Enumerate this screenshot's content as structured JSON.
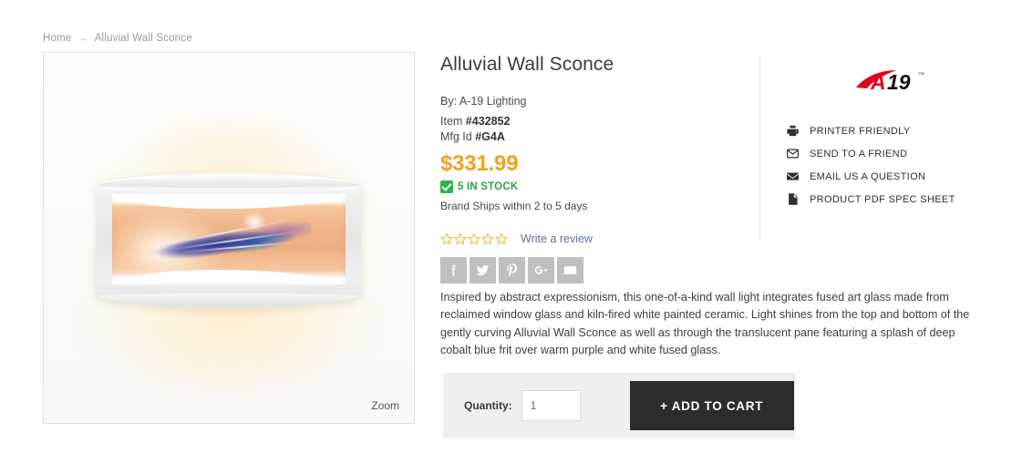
{
  "breadcrumb": {
    "home": "Home",
    "separator": "→",
    "current": "Alluvial Wall Sconce"
  },
  "gallery": {
    "zoom_label": "Zoom",
    "image_alt": "Alluvial Wall Sconce"
  },
  "product": {
    "title": "Alluvial Wall Sconce",
    "brand_line": "By: A-19 Lighting",
    "item_label": "Item ",
    "item_number": "#432852",
    "mfg_label": "Mfg Id ",
    "mfg_number": "#G4A",
    "price": "$331.99",
    "price_color": "#f5a01e",
    "stock_text": "5 IN STOCK",
    "stock_color": "#2e9d44",
    "shipping_text": "Brand Ships within 2 to 5 days",
    "description": "Inspired by abstract expressionism, this one-of-a-kind wall light integrates fused art glass made from reclaimed window glass and kiln-fired white painted ceramic. Light shines from the top and bottom of the gently curving Alluvial Wall Sconce as well as through the translucent pane featuring a splash of deep cobalt blue frit over warm purple and white fused glass."
  },
  "reviews": {
    "rating": 0,
    "star_count": 5,
    "star_color": "#f0b323",
    "write_review_label": "Write a review"
  },
  "social": {
    "buttons": [
      {
        "name": "facebook",
        "label": "f"
      },
      {
        "name": "twitter",
        "label": "Twitter"
      },
      {
        "name": "pinterest",
        "label": "P"
      },
      {
        "name": "googleplus",
        "label": "G+"
      },
      {
        "name": "email",
        "label": "Email"
      }
    ],
    "background_color": "#bfbfbf"
  },
  "brand_logo": {
    "text_a": "A",
    "text_19": "19",
    "accent_color": "#e2001a"
  },
  "utilities": [
    {
      "icon": "printer-icon",
      "label": "PRINTER FRIENDLY"
    },
    {
      "icon": "envelope-outline-icon",
      "label": "SEND TO A FRIEND"
    },
    {
      "icon": "envelope-filled-icon",
      "label": "EMAIL US A QUESTION"
    },
    {
      "icon": "document-icon",
      "label": "PRODUCT PDF SPEC SHEET"
    }
  ],
  "purchase": {
    "quantity_label": "Quantity:",
    "quantity_value": "1",
    "quantity_placeholder": "1",
    "add_to_cart_label": "+ ADD TO CART",
    "panel_color": "#efefef",
    "button_color": "#2d2d2d"
  }
}
